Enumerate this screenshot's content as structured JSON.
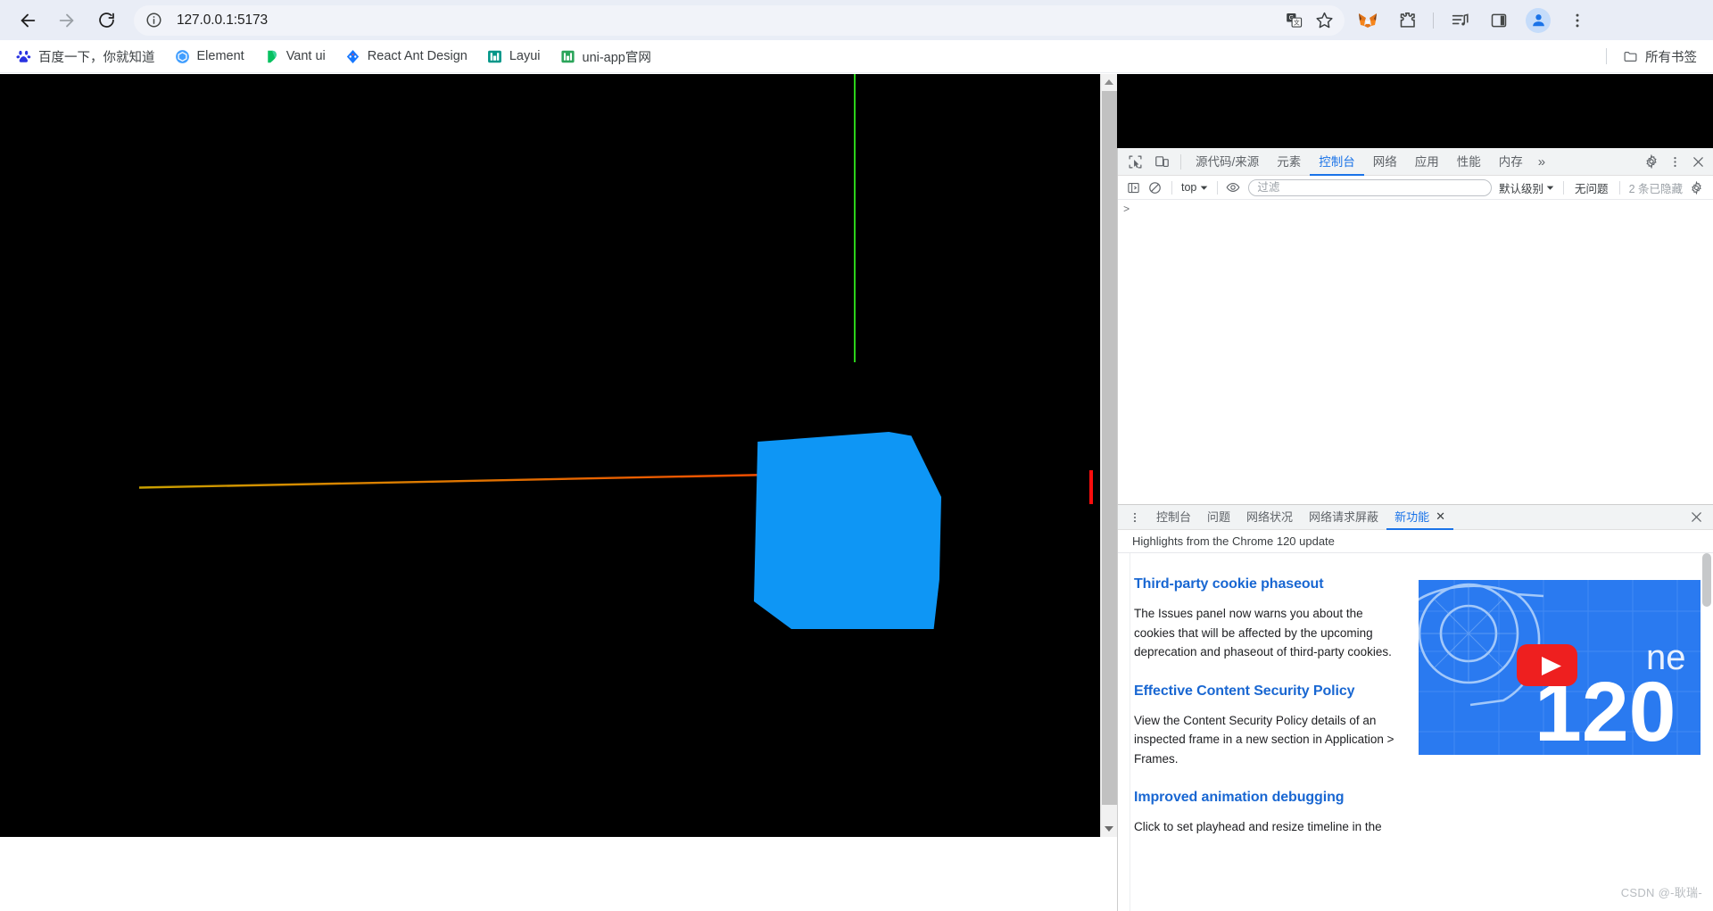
{
  "browser": {
    "nav": {
      "back": "back-arrow",
      "forward": "forward-arrow",
      "reload": "reload"
    },
    "omnibox": {
      "url": "127.0.0.1:5173",
      "site_info_icon": "info-circle-icon",
      "translate_icon": "translate-icon",
      "bookmark_icon": "star-icon"
    },
    "toolbar_icons": [
      {
        "name": "metamask-extension-icon",
        "label": "MetaMask"
      },
      {
        "name": "extensions-puzzle-icon",
        "label": "Extensions"
      },
      {
        "name": "media-playlist-icon",
        "label": "Media"
      },
      {
        "name": "side-panel-icon",
        "label": "Side panel"
      },
      {
        "name": "profile-avatar-icon",
        "label": "Profile"
      },
      {
        "name": "chrome-menu-icon",
        "label": "Customize and control Google Chrome"
      }
    ]
  },
  "bookmarks": {
    "items": [
      {
        "label": "百度一下，你就知道",
        "icon": "baidu-icon"
      },
      {
        "label": "Element",
        "icon": "element-icon"
      },
      {
        "label": "Vant ui",
        "icon": "vant-icon"
      },
      {
        "label": "React Ant Design",
        "icon": "antd-icon"
      },
      {
        "label": "Layui",
        "icon": "layui-icon"
      },
      {
        "label": "uni-app官网",
        "icon": "uniapp-icon"
      }
    ],
    "all_bookmarks": "所有书签",
    "all_bookmarks_icon": "folder-icon"
  },
  "page": {
    "scrollbar": {
      "up_arrow": "scroll-up-arrow",
      "down_arrow": "scroll-down-arrow"
    },
    "scene": {
      "background": "#000000",
      "cube_color": "#0e96f5",
      "y_axis_color": "#2bd11a",
      "x_axis_color_start": "#c8a000",
      "x_axis_color_end": "#f04b00",
      "red_marker_color": "#fc0d0d"
    }
  },
  "devtools": {
    "tool_icons": [
      {
        "name": "inspect-element-icon"
      },
      {
        "name": "device-toolbar-icon"
      }
    ],
    "tabs": [
      {
        "label": "源代码/来源",
        "active": false
      },
      {
        "label": "元素",
        "active": false
      },
      {
        "label": "控制台",
        "active": true
      },
      {
        "label": "网络",
        "active": false
      },
      {
        "label": "应用",
        "active": false
      },
      {
        "label": "性能",
        "active": false
      },
      {
        "label": "内存",
        "active": false
      }
    ],
    "more_tabs": "»",
    "right_icons": [
      {
        "name": "settings-gear-icon"
      },
      {
        "name": "devtools-more-options-icon"
      },
      {
        "name": "devtools-close-icon"
      }
    ],
    "console_toolbar": {
      "sidebar_toggle_icon": "console-sidebar-icon",
      "clear_icon": "clear-console-icon",
      "context": "top",
      "context_chevron": "chevron-down-icon",
      "live_expression_icon": "eye-icon",
      "filter_placeholder": "过滤",
      "filter_value": "",
      "level": "默认级别",
      "level_chevron": "chevron-down-icon",
      "issues": "无问题",
      "hidden_messages": "2 条已隐藏",
      "settings_icon": "console-settings-gear-icon"
    },
    "console_prompt": ">",
    "drawer": {
      "more_icon": "drawer-more-options-icon",
      "tabs": [
        {
          "label": "控制台",
          "active": false,
          "closable": false
        },
        {
          "label": "问题",
          "active": false,
          "closable": false
        },
        {
          "label": "网络状况",
          "active": false,
          "closable": false
        },
        {
          "label": "网络请求屏蔽",
          "active": false,
          "closable": false
        },
        {
          "label": "新功能",
          "active": true,
          "closable": true,
          "close_label": "✕"
        }
      ],
      "close_icon": "drawer-close-icon"
    },
    "whats_new": {
      "header": "Highlights from the Chrome 120 update",
      "entries": [
        {
          "title": "Third-party cookie phaseout",
          "body": "The Issues panel now warns you about the cookies that will be affected by the upcoming deprecation and phaseout of third-party cookies."
        },
        {
          "title": "Effective Content Security Policy",
          "body": "View the Content Security Policy details of an inspected frame in a new section in Application > Frames."
        },
        {
          "title": "Improved animation debugging",
          "body": "Click to set playhead and resize timeline in the"
        }
      ],
      "video_thumbnail": {
        "alt": "Chrome 120 what's new video",
        "overlay_text_partial": "ne",
        "version_text": "120",
        "play_icon": "youtube-play-icon",
        "background_color": "#2a7af0"
      }
    }
  },
  "watermark": "CSDN @-耿瑞-"
}
